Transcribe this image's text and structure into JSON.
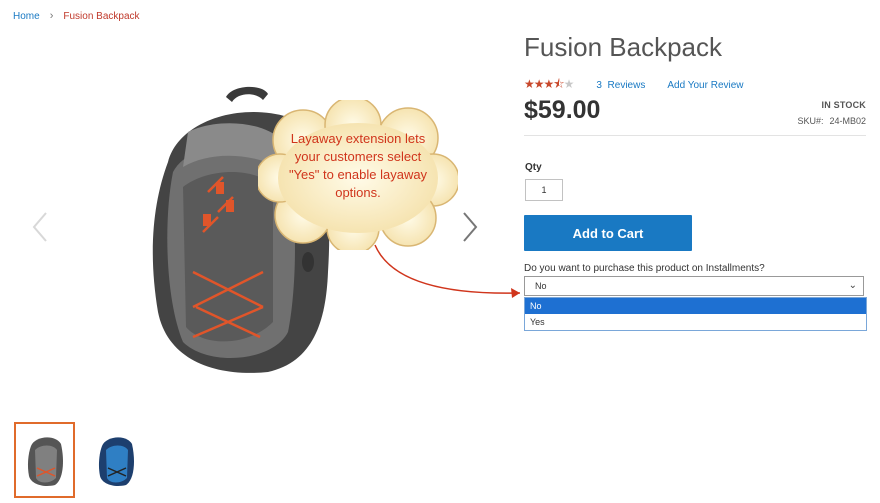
{
  "breadcrumb": {
    "home": "Home",
    "separator": "›",
    "current": "Fusion Backpack"
  },
  "callout": {
    "lines": [
      "Layaway extension lets",
      "your customers select",
      "\"Yes\" to enable layaway",
      "options."
    ]
  },
  "product": {
    "title": "Fusion Backpack",
    "rating": 3.5,
    "reviews_count": "3",
    "reviews_label": "Reviews",
    "add_review": "Add Your Review",
    "price": "$59.00",
    "stock": "IN STOCK",
    "sku_label": "SKU#:",
    "sku": "24-MB02",
    "qty_label": "Qty",
    "qty": "1",
    "add_to_cart": "Add to Cart",
    "installments_question": "Do you want to purchase this product on Installments?",
    "installments_selected": "No",
    "installments_options": [
      "No",
      "Yes"
    ]
  },
  "colors": {
    "accent": "#1979c3",
    "star": "#c8482b",
    "callout_text": "#d0351c",
    "thumb_active": "#e06b2b"
  },
  "icons": {
    "prev": "chevron-left-icon",
    "next": "chevron-right-icon",
    "select": "chevron-down-icon"
  }
}
